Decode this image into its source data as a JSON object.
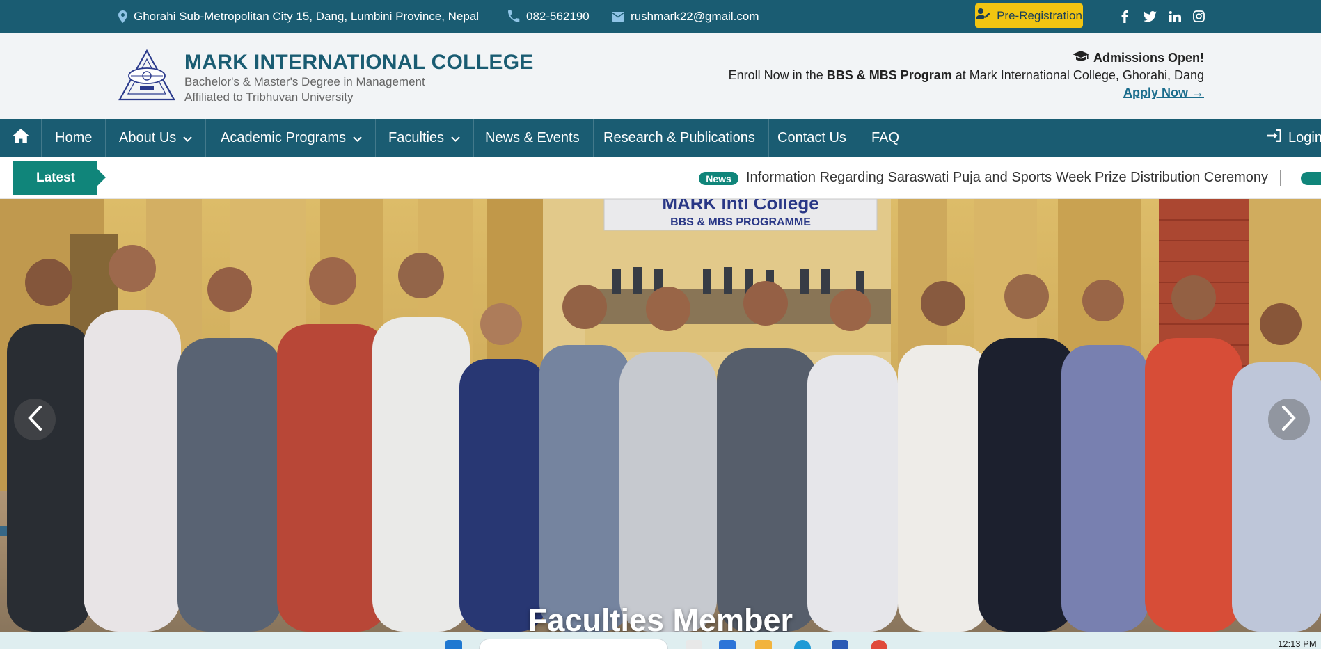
{
  "topbar": {
    "address": "Ghorahi Sub-Metropolitan City 15, Dang, Lumbini Province, Nepal",
    "phone": "082-562190",
    "email": "rushmark22@gmail.com",
    "pre_registration": "Pre-Registration",
    "social_icons": [
      "facebook-icon",
      "twitter-icon",
      "linkedin-icon",
      "instagram-icon"
    ],
    "bar_color": "#1a5c72",
    "button_color": "#f2c511"
  },
  "header": {
    "college_name": "MARK INTERNATIONAL COLLEGE",
    "tagline_1": "Bachelor's & Master's Degree in Management",
    "tagline_2": "Affiliated to Tribhuvan University",
    "admissions_title": "Admissions Open!",
    "enroll_prefix": "Enroll Now in the",
    "enroll_program": "BBS & MBS Program",
    "enroll_suffix": "at Mark International College, Ghorahi, Dang",
    "apply_link": "Apply Now →"
  },
  "nav": {
    "items": [
      {
        "label": "Home"
      },
      {
        "label": "About Us"
      },
      {
        "label": "Academic Programs"
      },
      {
        "label": "Faculties"
      },
      {
        "label": "News & Events"
      },
      {
        "label": "Research & Publications"
      },
      {
        "label": "Contact Us"
      },
      {
        "label": "FAQ"
      }
    ],
    "login": "Login"
  },
  "ticker": {
    "latest_label": "Latest",
    "badge": "News",
    "headline": "Information Regarding Saraswati Puja and Sports Week Prize Distribution Ceremony",
    "accent_color": "#10857a"
  },
  "hero": {
    "banner_line_1": "MARK Intl College",
    "banner_line_2": "BBS & MBS PROGRAMME",
    "caption": "Faculties Member"
  },
  "taskbar": {
    "time": "12:13 PM"
  }
}
